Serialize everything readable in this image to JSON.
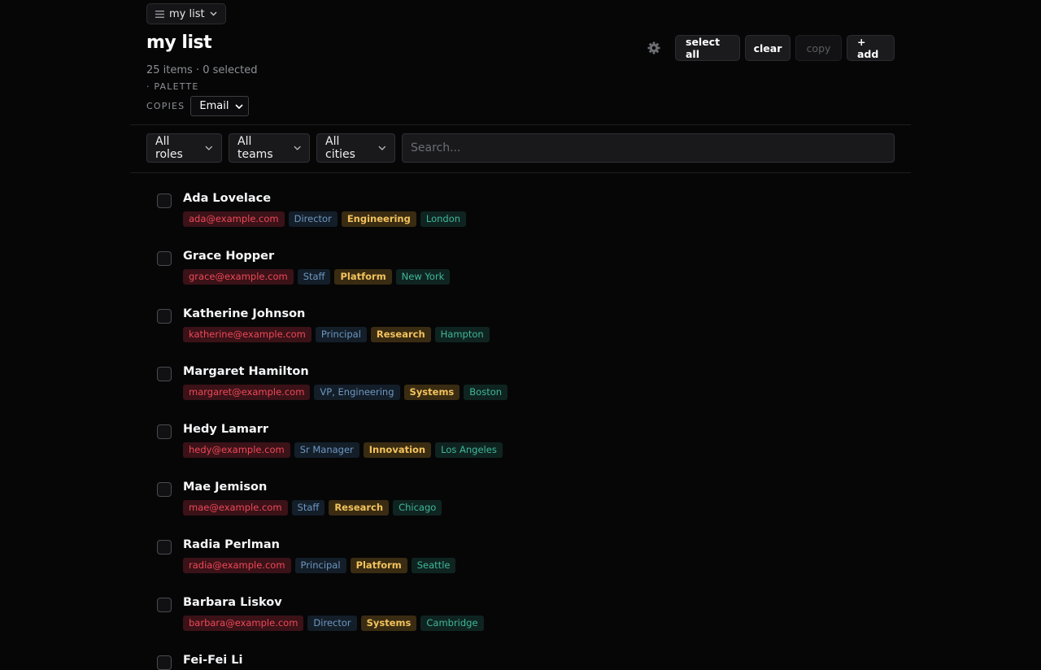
{
  "list_switcher": {
    "label": "my list"
  },
  "header": {
    "title": "my list",
    "summary": "25 items · 0 selected",
    "palette_label": "· PALETTE",
    "copies_label": "COPIES",
    "copies_value": "Email"
  },
  "toolbar": {
    "settings_icon": "gear-icon",
    "select_all": "select all",
    "clear": "clear",
    "copy": "copy",
    "add": "+ add"
  },
  "filters": {
    "roles": "All roles",
    "teams": "All teams",
    "cities": "All cities",
    "search_placeholder": "Search..."
  },
  "colors": {
    "email": "#f0485a",
    "role": "#6f97c0",
    "team": "#f3c35d",
    "city": "#3fb79b"
  },
  "people": [
    {
      "name": "Ada Lovelace",
      "email": "ada@example.com",
      "role": "Director",
      "team": "Engineering",
      "city": "London"
    },
    {
      "name": "Grace Hopper",
      "email": "grace@example.com",
      "role": "Staff",
      "team": "Platform",
      "city": "New York"
    },
    {
      "name": "Katherine Johnson",
      "email": "katherine@example.com",
      "role": "Principal",
      "team": "Research",
      "city": "Hampton"
    },
    {
      "name": "Margaret Hamilton",
      "email": "margaret@example.com",
      "role": "VP, Engineering",
      "team": "Systems",
      "city": "Boston"
    },
    {
      "name": "Hedy Lamarr",
      "email": "hedy@example.com",
      "role": "Sr Manager",
      "team": "Innovation",
      "city": "Los Angeles"
    },
    {
      "name": "Mae Jemison",
      "email": "mae@example.com",
      "role": "Staff",
      "team": "Research",
      "city": "Chicago"
    },
    {
      "name": "Radia Perlman",
      "email": "radia@example.com",
      "role": "Principal",
      "team": "Platform",
      "city": "Seattle"
    },
    {
      "name": "Barbara Liskov",
      "email": "barbara@example.com",
      "role": "Director",
      "team": "Systems",
      "city": "Cambridge"
    },
    {
      "name": "Fei-Fei Li"
    }
  ]
}
